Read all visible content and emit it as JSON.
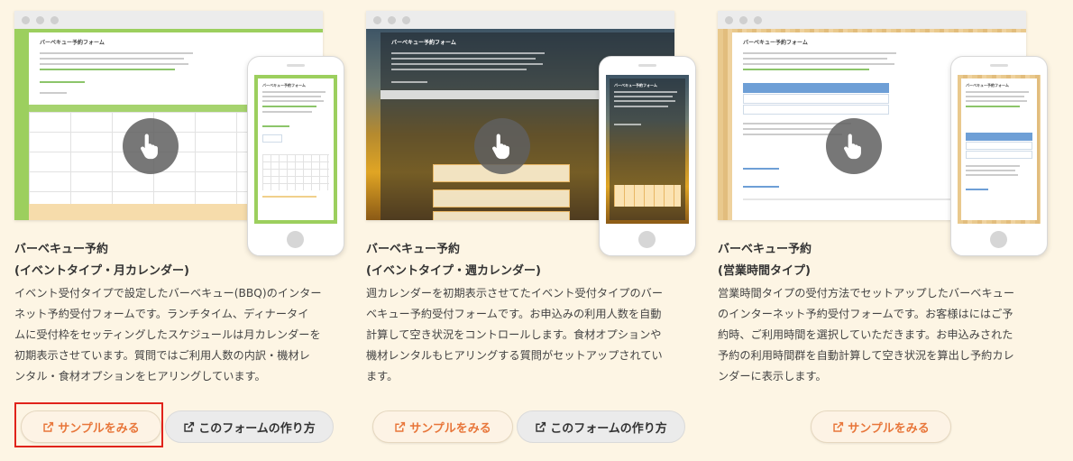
{
  "cards": [
    {
      "preview": {
        "form_title": "バーベキュー予約フォーム",
        "theme": "green",
        "icon": "hand-pointer-icon"
      },
      "title_line1": "バーベキュー予約",
      "title_line2": "(イベントタイプ・月カレンダー)",
      "desc_lines": [
        "イベント受付タイプで設定したバーベキュー(BBQ)のインター",
        "ネット予約受付フォームです。ランチタイム、ディナータイ",
        "ムに受付枠をセッティングしたスケジュールは月カレンダーを",
        "初期表示させています。質問ではご利用人数の内訳・機材レ",
        "ンタル・食材オプションをヒアリングしています。"
      ],
      "sample_label": "サンプルをみる",
      "howto_label": "このフォームの作り方",
      "sample_highlighted": true
    },
    {
      "preview": {
        "form_title": "バーベキュー予約フォーム",
        "theme": "sunflower",
        "icon": "hand-pointer-icon"
      },
      "title_line1": "バーベキュー予約",
      "title_line2": "(イベントタイプ・週カレンダー)",
      "desc_lines": [
        "週カレンダーを初期表示させてたイベント受付タイプのバー",
        "ベキュー予約受付フォームです。お申込みの利用人数を自動",
        "計算して空き状況をコントロールします。食材オプションや",
        "機材レンタルもヒアリングする質問がセットアップされてい",
        "ます。"
      ],
      "sample_label": "サンプルをみる",
      "howto_label": "このフォームの作り方"
    },
    {
      "preview": {
        "form_title": "バーベキュー予約フォーム",
        "theme": "wood",
        "icon": "hand-pointer-icon"
      },
      "title_line1": "バーベキュー予約",
      "title_line2": "(営業時間タイプ)",
      "desc_lines": [
        "営業時間タイプの受付方法でセットアップしたバーベキュー",
        "のインターネット予約受付フォームです。お客様はにはご予",
        "約時、ご利用時間を選択していただきます。お申込みされた",
        "予約の利用時間群を自動計算して空き状況を算出し予約カレ",
        "ンダーに表示します。"
      ],
      "sample_label": "サンプルをみる"
    }
  ],
  "colors": {
    "accent": "#e8763a",
    "highlight": "#e0231b",
    "background": "#fdf5e4"
  }
}
